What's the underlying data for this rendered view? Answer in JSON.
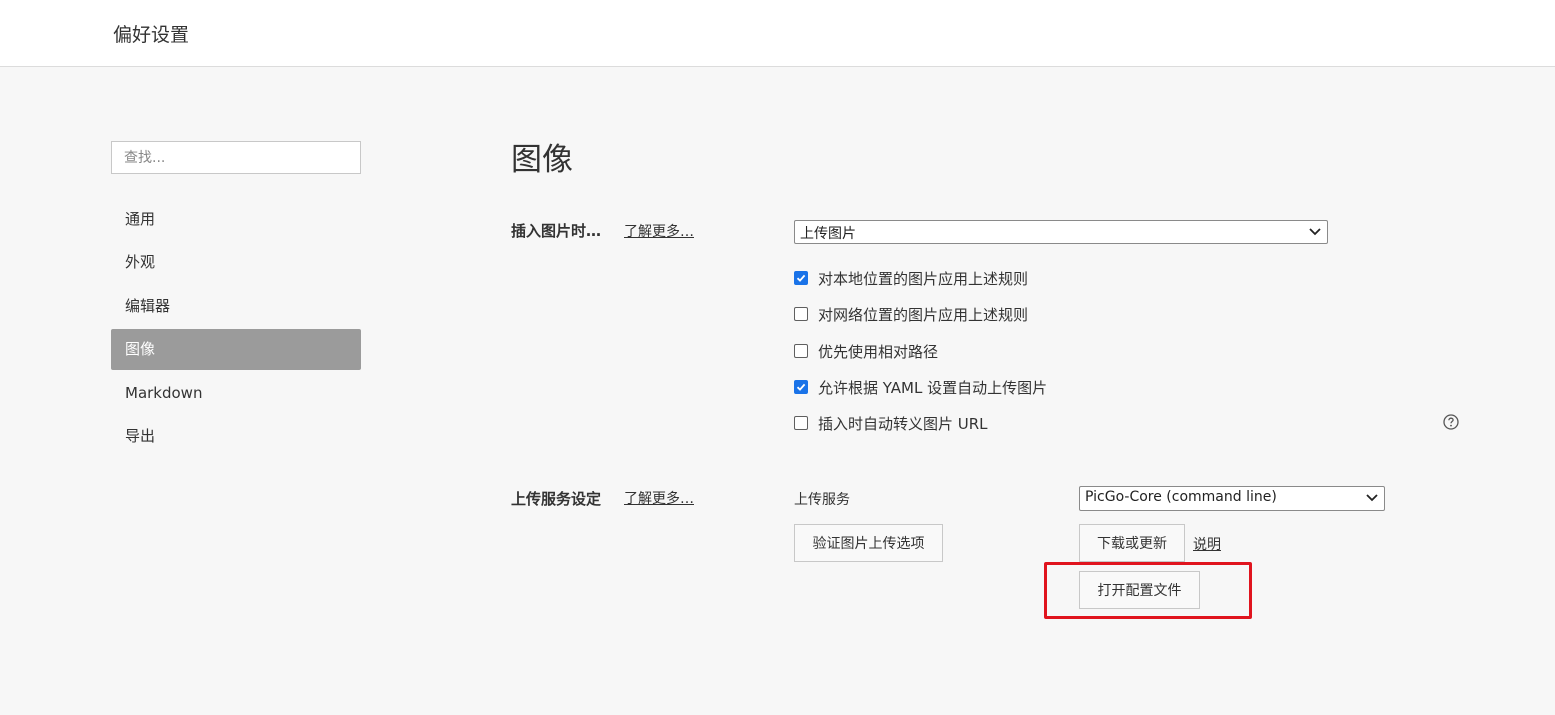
{
  "window": {
    "title": "偏好设置"
  },
  "sidebar": {
    "search_placeholder": "查找...",
    "items": [
      {
        "label": "通用",
        "active": false
      },
      {
        "label": "外观",
        "active": false
      },
      {
        "label": "编辑器",
        "active": false
      },
      {
        "label": "图像",
        "active": true
      },
      {
        "label": "Markdown",
        "active": false
      },
      {
        "label": "导出",
        "active": false
      }
    ]
  },
  "main": {
    "title": "图像",
    "insert_section": {
      "label": "插入图片时…",
      "learn_more": "了解更多…",
      "dropdown_value": "上传图片",
      "options": [
        {
          "label": "对本地位置的图片应用上述规则",
          "checked": true
        },
        {
          "label": "对网络位置的图片应用上述规则",
          "checked": false
        },
        {
          "label": "优先使用相对路径",
          "checked": false
        },
        {
          "label": "允许根据 YAML 设置自动上传图片",
          "checked": true
        },
        {
          "label": "插入时自动转义图片 URL",
          "checked": false
        }
      ]
    },
    "upload_section": {
      "label": "上传服务设定",
      "learn_more": "了解更多…",
      "service_label": "上传服务",
      "service_value": "PicGo-Core (command line)",
      "verify_button": "验证图片上传选项",
      "download_button": "下载或更新",
      "explain_link": "说明",
      "open_config_button": "打开配置文件"
    }
  },
  "colors": {
    "accent": "#1a73e8",
    "active_nav": "#9b9b9b",
    "highlight": "#e0141e"
  },
  "icons": {
    "help": "help-circle-icon",
    "dropdown": "chevron-down-icon",
    "check": "check-icon"
  }
}
